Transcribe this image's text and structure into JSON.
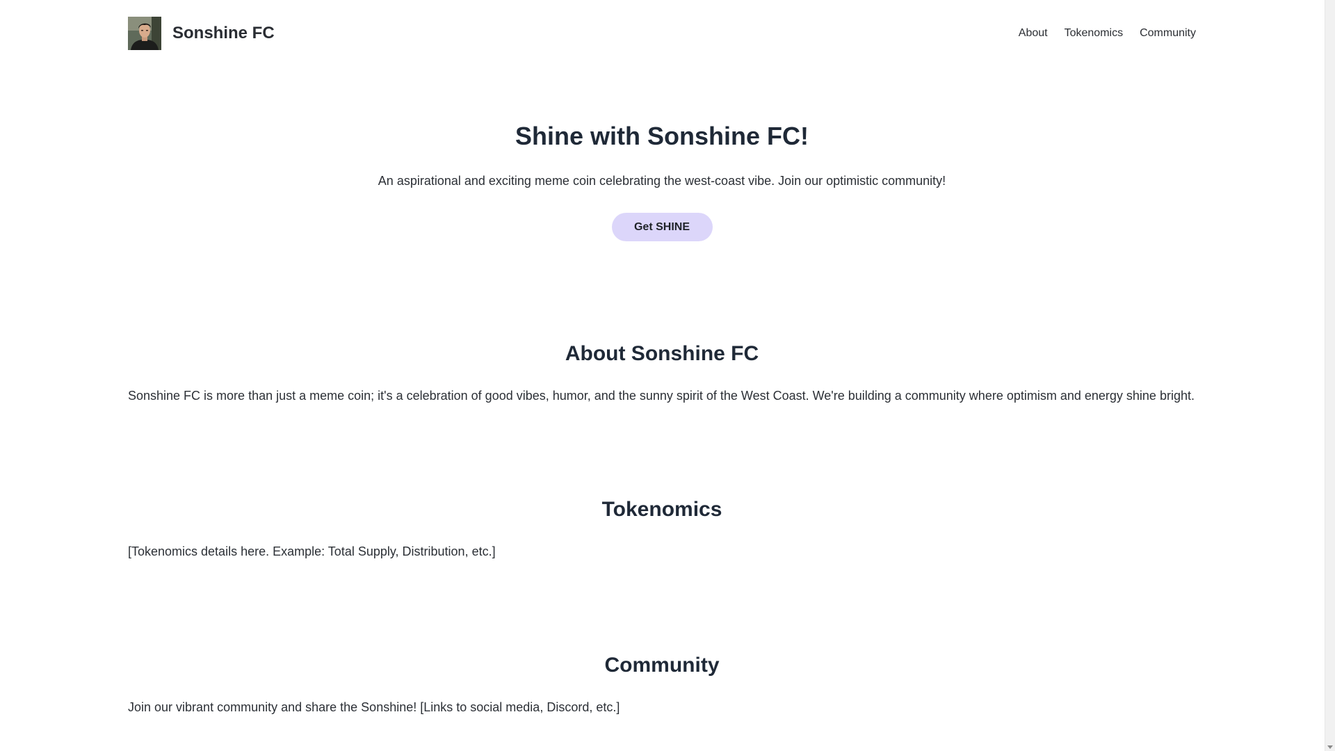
{
  "header": {
    "brand_name": "Sonshine FC",
    "nav": [
      "About",
      "Tokenomics",
      "Community"
    ]
  },
  "hero": {
    "title": "Shine with Sonshine FC!",
    "subtitle": "An aspirational and exciting meme coin celebrating the west-coast vibe. Join our optimistic community!",
    "cta_label": "Get SHINE"
  },
  "about": {
    "heading": "About Sonshine FC",
    "body": "Sonshine FC is more than just a meme coin; it's a celebration of good vibes, humor, and the sunny spirit of the West Coast. We're building a community where optimism and energy shine bright."
  },
  "tokenomics": {
    "heading": "Tokenomics",
    "body": "[Tokenomics details here. Example: Total Supply, Distribution, etc.]"
  },
  "community": {
    "heading": "Community",
    "body": "Join our vibrant community and share the Sonshine! [Links to social media, Discord, etc.]"
  },
  "colors": {
    "cta_background": "#dcd6fa",
    "text": "#1f2937"
  }
}
